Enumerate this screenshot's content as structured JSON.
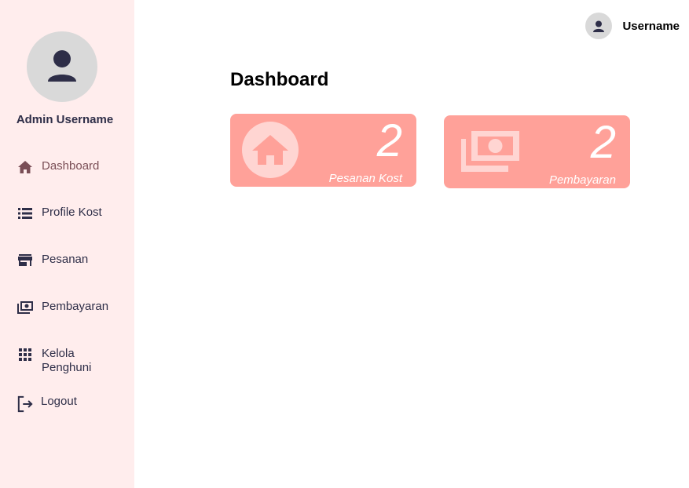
{
  "sidebar": {
    "admin_name": "Admin Username",
    "items": [
      {
        "label": "Dashboard",
        "icon": "home-icon",
        "active": true
      },
      {
        "label": "Profile Kost",
        "icon": "list-icon"
      },
      {
        "label": "Pesanan",
        "icon": "store-icon"
      },
      {
        "label": "Pembayaran",
        "icon": "money-icon"
      },
      {
        "label": "Kelola\nPenghuni",
        "icon": "grid-icon"
      },
      {
        "label": "Logout",
        "icon": "logout-icon"
      }
    ]
  },
  "header": {
    "username": "Username"
  },
  "main": {
    "title": "Dashboard",
    "cards": [
      {
        "count": "2",
        "caption": "Pesanan Kost",
        "icon": "home-icon"
      },
      {
        "count": "2",
        "caption": "Pembayaran",
        "icon": "money-icon"
      }
    ]
  },
  "colors": {
    "sidebar_bg": "#ffeded",
    "card_bg": "#ffa199",
    "card_icon": "#ffd5d2",
    "text_dark": "#2e2e48",
    "active_text": "#7a4e56"
  }
}
